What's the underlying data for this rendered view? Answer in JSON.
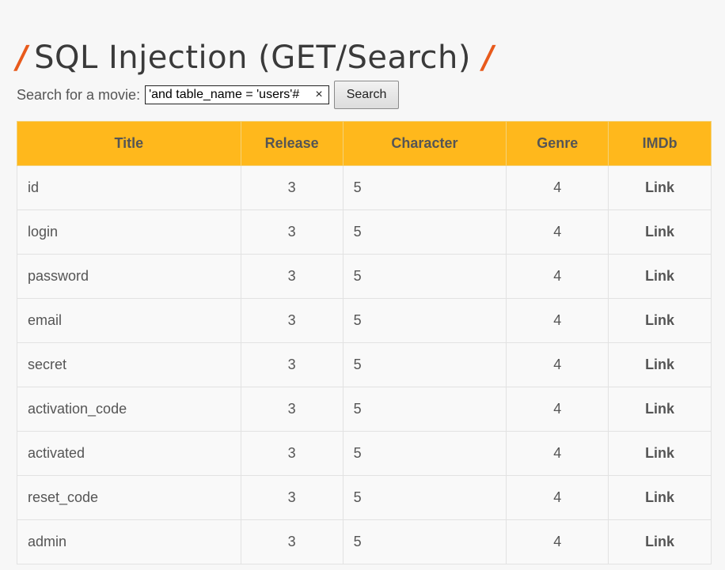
{
  "page": {
    "title": "SQL Injection (GET/Search)",
    "accent_color": "#e85a1c",
    "header_color": "#ffb81c"
  },
  "search": {
    "label": "Search for a movie:",
    "value": "'and table_name = 'users'#",
    "clear_icon": "×",
    "button_label": "Search"
  },
  "table": {
    "headers": [
      "Title",
      "Release",
      "Character",
      "Genre",
      "IMDb"
    ],
    "rows": [
      {
        "title": "id",
        "release": "3",
        "character": "5",
        "genre": "4",
        "imdb": "Link"
      },
      {
        "title": "login",
        "release": "3",
        "character": "5",
        "genre": "4",
        "imdb": "Link"
      },
      {
        "title": "password",
        "release": "3",
        "character": "5",
        "genre": "4",
        "imdb": "Link"
      },
      {
        "title": "email",
        "release": "3",
        "character": "5",
        "genre": "4",
        "imdb": "Link"
      },
      {
        "title": "secret",
        "release": "3",
        "character": "5",
        "genre": "4",
        "imdb": "Link"
      },
      {
        "title": "activation_code",
        "release": "3",
        "character": "5",
        "genre": "4",
        "imdb": "Link"
      },
      {
        "title": "activated",
        "release": "3",
        "character": "5",
        "genre": "4",
        "imdb": "Link"
      },
      {
        "title": "reset_code",
        "release": "3",
        "character": "5",
        "genre": "4",
        "imdb": "Link"
      },
      {
        "title": "admin",
        "release": "3",
        "character": "5",
        "genre": "4",
        "imdb": "Link"
      }
    ]
  }
}
